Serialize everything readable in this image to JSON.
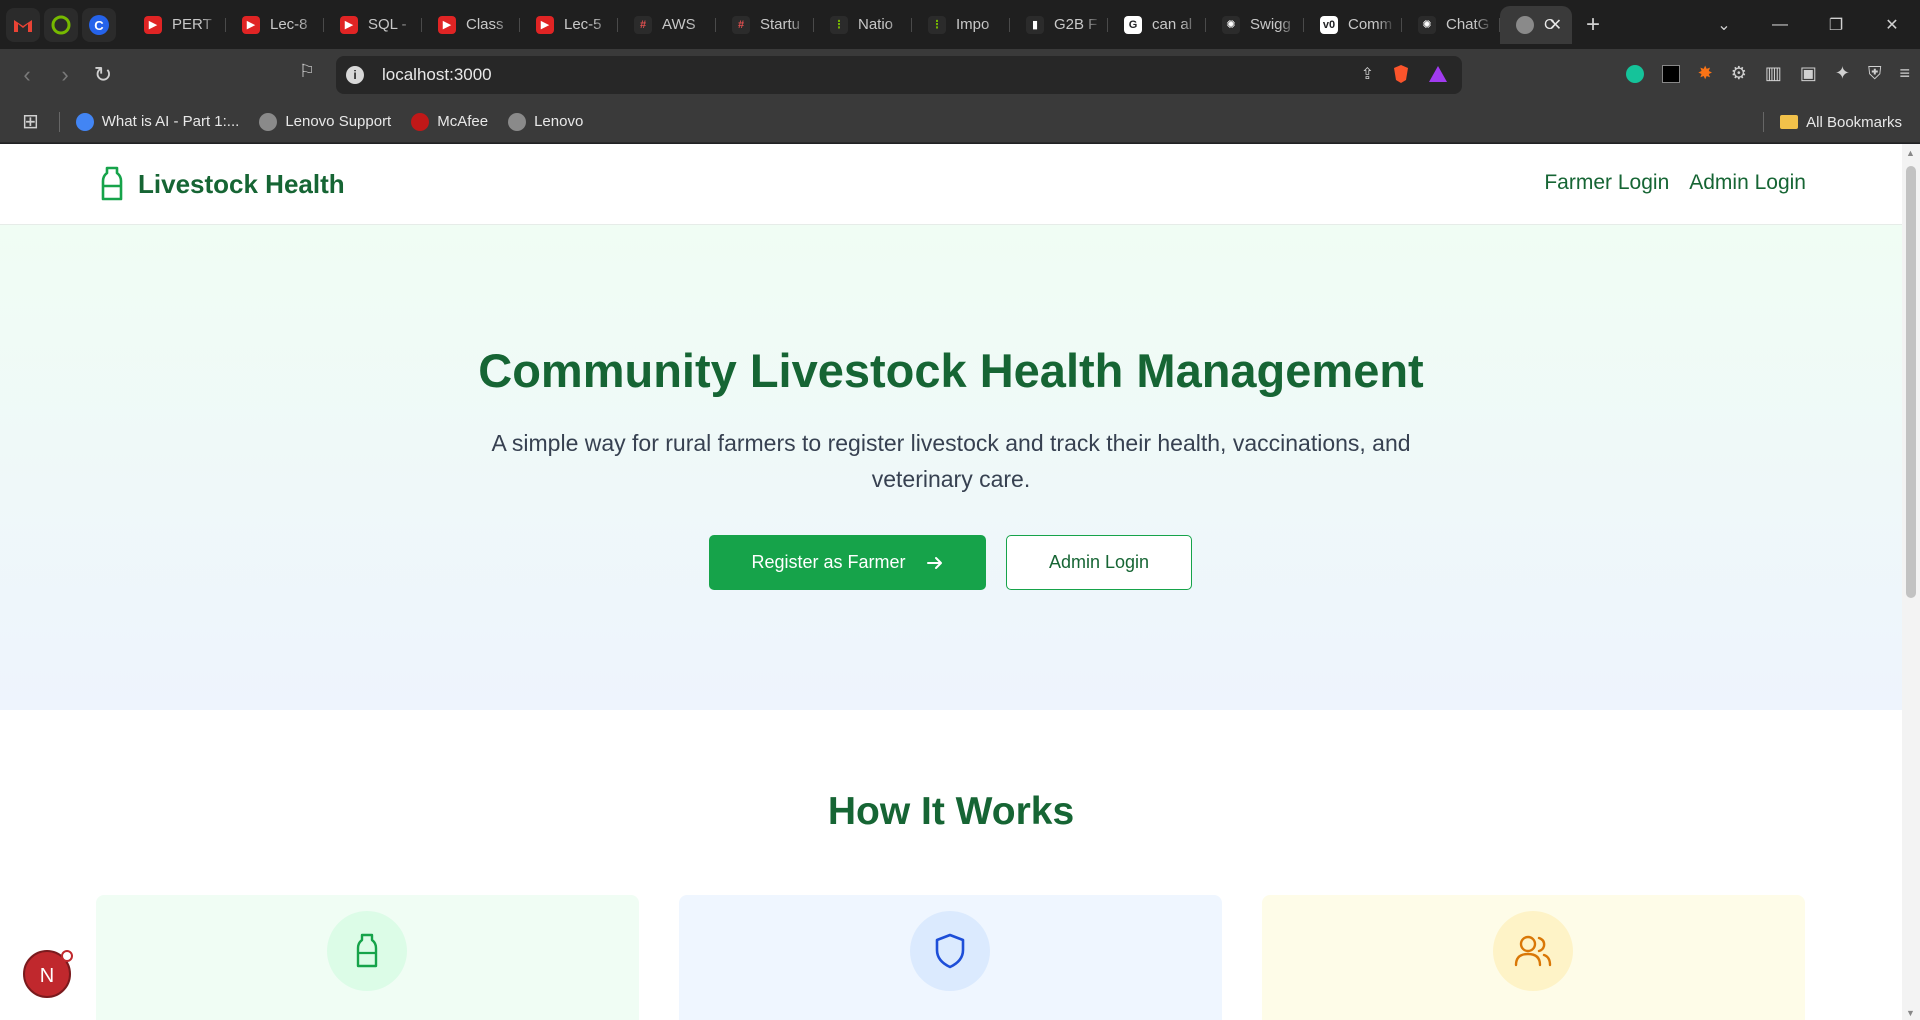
{
  "browser": {
    "tabs": [
      {
        "title": "PERT",
        "color": "#e02424",
        "glyph": "▶"
      },
      {
        "title": "Lec-8",
        "color": "#e02424",
        "glyph": "▶"
      },
      {
        "title": "SQL -",
        "color": "#e02424",
        "glyph": "▶"
      },
      {
        "title": "Class",
        "color": "#e02424",
        "glyph": "▶"
      },
      {
        "title": "Lec-5",
        "color": "#e02424",
        "glyph": "▶"
      },
      {
        "title": "AWS",
        "color": "#2b2b2b",
        "glyph": "#"
      },
      {
        "title": "Startu",
        "color": "#2b2b2b",
        "glyph": "#"
      },
      {
        "title": "Natio",
        "color": "#2b2b2b",
        "glyph": "⋮"
      },
      {
        "title": "Impo",
        "color": "#2b2b2b",
        "glyph": "⋮"
      },
      {
        "title": "G2B F",
        "color": "#2b2b2b",
        "glyph": "▮"
      },
      {
        "title": "can al",
        "color": "#ffffff",
        "glyph": "G"
      },
      {
        "title": "Swigg",
        "color": "#2b2b2b",
        "glyph": "✺"
      },
      {
        "title": "Comm",
        "color": "#ffffff",
        "glyph": "v0"
      },
      {
        "title": "ChatG",
        "color": "#2b2b2b",
        "glyph": "✺"
      }
    ],
    "active_tab": {
      "title": "C",
      "close": "✕"
    },
    "new_tab": "+",
    "url": "localhost:3000",
    "bookmarks": [
      {
        "label": "What is AI - Part 1:...",
        "color": "#4285f4"
      },
      {
        "label": "Lenovo Support",
        "color": "#8a8a8a"
      },
      {
        "label": "McAfee",
        "color": "#c01818"
      },
      {
        "label": "Lenovo",
        "color": "#8a8a8a"
      }
    ],
    "all_bookmarks": "All Bookmarks"
  },
  "site": {
    "brand": "Livestock Health",
    "nav": {
      "farmer_login": "Farmer Login",
      "admin_login": "Admin Login"
    }
  },
  "hero": {
    "title": "Community Livestock Health Management",
    "subtitle": "A simple way for rural farmers to register livestock and track their health, vaccinations, and veterinary care.",
    "primary_button": "Register as Farmer",
    "secondary_button": "Admin Login"
  },
  "how_it_works": {
    "heading": "How It Works",
    "cards": [
      {
        "icon": "bottle-icon",
        "bg": "#f0fdf4",
        "circle": "#dcfce7",
        "accent": "#16a34a"
      },
      {
        "icon": "shield-icon",
        "bg": "#eff6ff",
        "circle": "#dbeafe",
        "accent": "#1d4ed8"
      },
      {
        "icon": "users-icon",
        "bg": "#fefce8",
        "circle": "#fef3c7",
        "accent": "#d97706"
      }
    ]
  },
  "fab": {
    "label": "N"
  },
  "colors": {
    "brand_green": "#166534",
    "button_green": "#16a34a"
  }
}
